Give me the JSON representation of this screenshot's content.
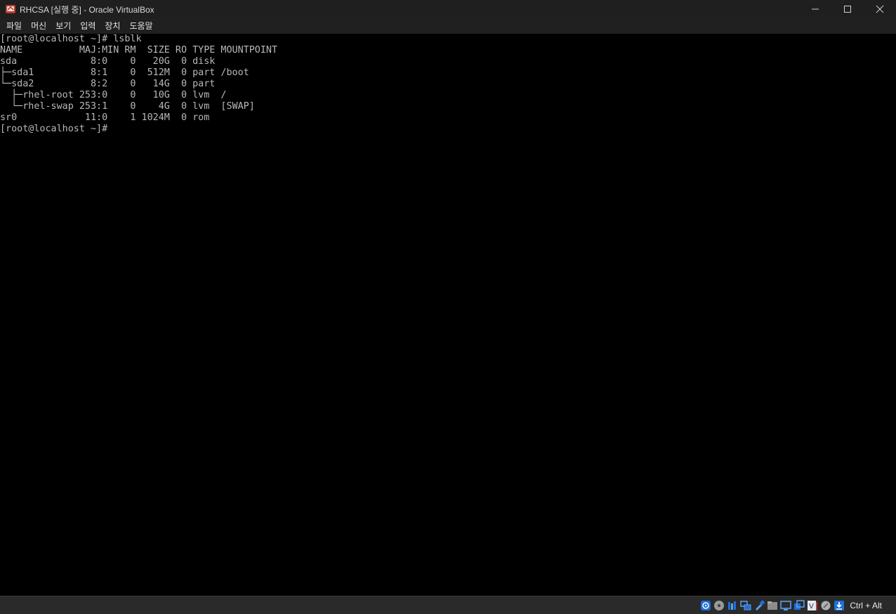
{
  "titlebar": {
    "title": "RHCSA [실행 중] - Oracle VirtualBox",
    "app_icon": "virtualbox-icon",
    "controls": {
      "minimize": "minimize-icon",
      "maximize": "maximize-icon",
      "close": "close-icon"
    }
  },
  "menubar": {
    "items": [
      "파일",
      "머신",
      "보기",
      "입력",
      "장치",
      "도움말"
    ]
  },
  "console": {
    "lines": [
      "[root@localhost ~]# lsblk",
      "NAME          MAJ:MIN RM  SIZE RO TYPE MOUNTPOINT",
      "sda             8:0    0   20G  0 disk",
      "├─sda1          8:1    0  512M  0 part /boot",
      "└─sda2          8:2    0   14G  0 part",
      "  ├─rhel-root 253:0    0   10G  0 lvm  /",
      "  └─rhel-swap 253:1    0    4G  0 lvm  [SWAP]",
      "sr0            11:0    1 1024M  0 rom",
      "[root@localhost ~]#"
    ],
    "text_color": "#b8b8b8",
    "background": "#000000"
  },
  "statusbar": {
    "icons": [
      "hard-disk-icon",
      "optical-drive-icon",
      "audio-icon",
      "network-icon",
      "usb-icon",
      "shared-folders-icon",
      "display-icon",
      "video-capture-icon",
      "virtualization-icon",
      "mouse-integration-icon",
      "keyboard-capture-icon"
    ],
    "host_key": "Ctrl + Alt"
  }
}
